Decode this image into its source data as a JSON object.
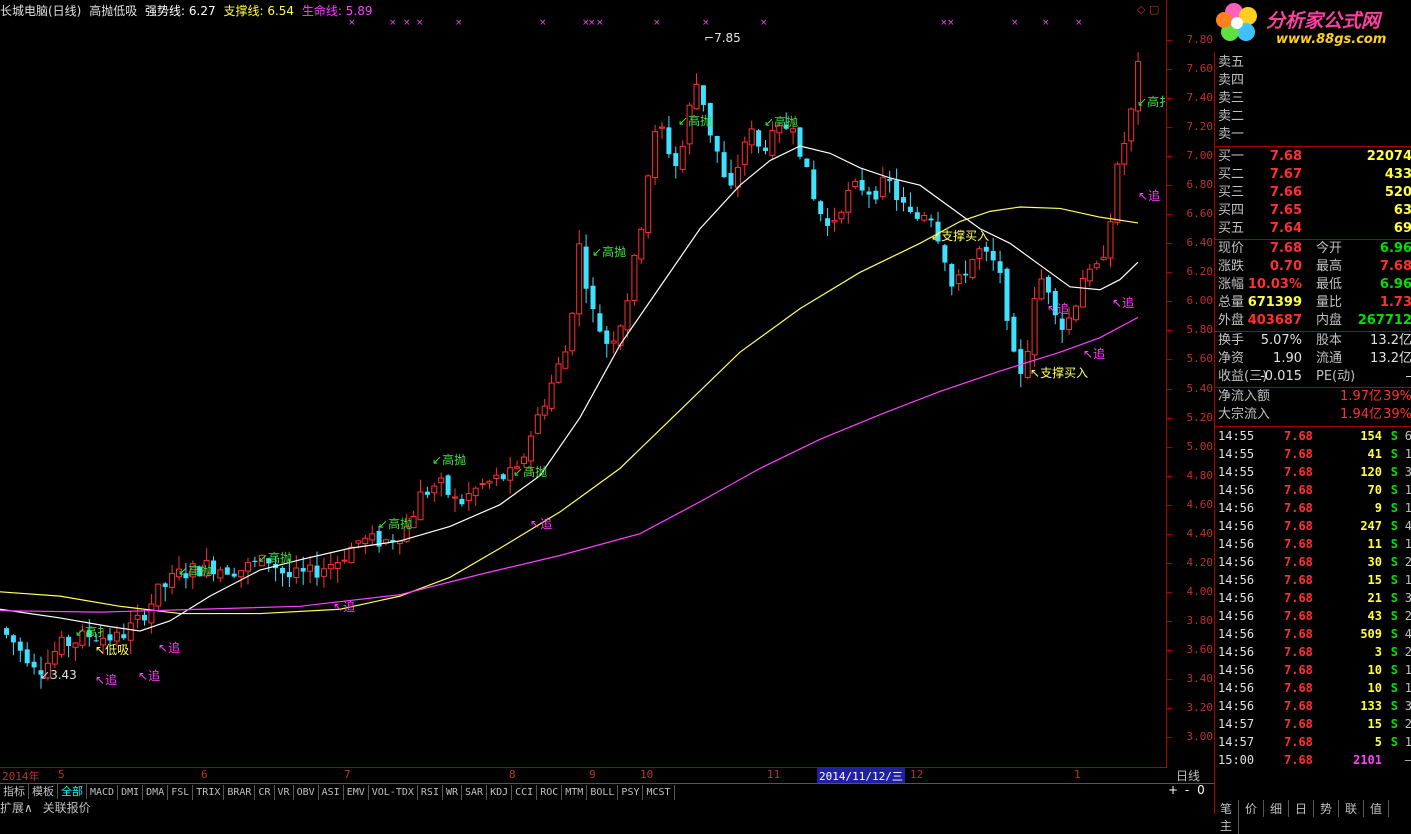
{
  "header": {
    "title": "长城电脑(日线)",
    "indicator": "高抛低吸",
    "line1_label": "强势线:",
    "line1_value": "6.27",
    "line2_label": "支撑线:",
    "line2_value": "6.54",
    "line3_label": "生命线:",
    "line3_value": "5.89",
    "icons": "◇ ▢"
  },
  "colors": {
    "up": "#ff3030",
    "down": "#40e0ff",
    "ma_white": "#ffffff",
    "ma_yellow": "#ffff60",
    "ma_magenta": "#ff40ff",
    "grid": "#a00000"
  },
  "price_axis": [
    "7.80",
    "7.60",
    "7.40",
    "7.20",
    "7.00",
    "6.80",
    "6.60",
    "6.40",
    "6.20",
    "6.00",
    "5.80",
    "5.60",
    "5.40",
    "5.20",
    "5.00",
    "4.80",
    "4.60",
    "4.40",
    "4.20",
    "4.00",
    "3.80",
    "3.60",
    "3.40",
    "3.20",
    "3.00"
  ],
  "date_axis": [
    {
      "label": "2014年",
      "x": 2
    },
    {
      "label": "5",
      "x": 58
    },
    {
      "label": "6",
      "x": 201
    },
    {
      "label": "7",
      "x": 344
    },
    {
      "label": "8",
      "x": 509
    },
    {
      "label": "9",
      "x": 589
    },
    {
      "label": "10",
      "x": 640
    },
    {
      "label": "11",
      "x": 767
    },
    {
      "label": "2014/11/12/三",
      "x": 817,
      "selected": true
    },
    {
      "label": "12",
      "x": 910
    },
    {
      "label": "1",
      "x": 1074
    }
  ],
  "period": "日线",
  "annotations": {
    "high": "7.85",
    "low": "3.43"
  },
  "signals": {
    "sell": "高抛",
    "buy_low": "低吸",
    "chase": "追",
    "support": "支撑买入",
    "sell_short": "高扌"
  },
  "chart_data": {
    "type": "candlestick",
    "title": "长城电脑(日线) 高抛低吸",
    "ylim": [
      3.0,
      7.85
    ],
    "series_names": [
      "强势线",
      "支撑线",
      "生命线"
    ],
    "latest_values": {
      "强势线": 6.27,
      "支撑线": 6.54,
      "生命线": 5.89
    },
    "high_label": 7.85,
    "low_label": 3.43
  },
  "tabs": {
    "side": [
      "指标",
      "模板",
      "全部"
    ],
    "items": [
      "MACD",
      "DMI",
      "DMA",
      "FSL",
      "TRIX",
      "BRAR",
      "CR",
      "VR",
      "OBV",
      "ASI",
      "EMV",
      "VOL-TDX",
      "RSI",
      "WR",
      "SAR",
      "KDJ",
      "CCI",
      "ROC",
      "MTM",
      "BOLL",
      "PSY",
      "MCST"
    ]
  },
  "zoom": {
    "plus": "+",
    "minus": "-",
    "zero": "0"
  },
  "bottom": {
    "expand": "扩展∧",
    "related": "关联报价"
  },
  "logo": {
    "text": "分析家公式网",
    "url": "www.88gs.com"
  },
  "panel": {
    "sell_rows": [
      "卖五",
      "卖四",
      "卖三",
      "卖二",
      "卖一"
    ],
    "buy_rows": [
      {
        "label": "买一",
        "price": "7.68",
        "vol": "22074"
      },
      {
        "label": "买二",
        "price": "7.67",
        "vol": "433"
      },
      {
        "label": "买三",
        "price": "7.66",
        "vol": "520"
      },
      {
        "label": "买四",
        "price": "7.65",
        "vol": "63"
      },
      {
        "label": "买五",
        "price": "7.64",
        "vol": "69"
      }
    ],
    "quote": [
      {
        "l1": "现价",
        "v1": "7.68",
        "l2": "今开",
        "v2": "6.96"
      },
      {
        "l1": "涨跌",
        "v1": "0.70",
        "l2": "最高",
        "v2": "7.68"
      },
      {
        "l1": "涨幅",
        "v1": "10.03%",
        "l2": "最低",
        "v2": "6.96"
      },
      {
        "l1": "总量",
        "v1": "671399",
        "l2": "量比",
        "v2": "1.73"
      },
      {
        "l1": "外盘",
        "v1": "403687",
        "l2": "内盘",
        "v2": "267712"
      }
    ],
    "info": [
      {
        "l1": "换手",
        "v1": "5.07%",
        "l2": "股本",
        "v2": "13.2亿"
      },
      {
        "l1": "净资",
        "v1": "1.90",
        "l2": "流通",
        "v2": "13.2亿"
      },
      {
        "l1": "收益(三)",
        "v1": "-0.015",
        "l2": "PE(动)",
        "v2": "–"
      }
    ],
    "flow": [
      {
        "l": "净流入额",
        "v": "1.97亿",
        "p": "39%"
      },
      {
        "l": "大宗流入",
        "v": "1.94亿",
        "p": "39%"
      }
    ],
    "ticks": [
      {
        "t": "14:55",
        "p": "7.68",
        "v": "154",
        "s": "S",
        "n": "6"
      },
      {
        "t": "14:55",
        "p": "7.68",
        "v": "41",
        "s": "S",
        "n": "1"
      },
      {
        "t": "14:55",
        "p": "7.68",
        "v": "120",
        "s": "S",
        "n": "3"
      },
      {
        "t": "14:56",
        "p": "7.68",
        "v": "70",
        "s": "S",
        "n": "1"
      },
      {
        "t": "14:56",
        "p": "7.68",
        "v": "9",
        "s": "S",
        "n": "1"
      },
      {
        "t": "14:56",
        "p": "7.68",
        "v": "247",
        "s": "S",
        "n": "4"
      },
      {
        "t": "14:56",
        "p": "7.68",
        "v": "11",
        "s": "S",
        "n": "1"
      },
      {
        "t": "14:56",
        "p": "7.68",
        "v": "30",
        "s": "S",
        "n": "2"
      },
      {
        "t": "14:56",
        "p": "7.68",
        "v": "15",
        "s": "S",
        "n": "1"
      },
      {
        "t": "14:56",
        "p": "7.68",
        "v": "21",
        "s": "S",
        "n": "3"
      },
      {
        "t": "14:56",
        "p": "7.68",
        "v": "43",
        "s": "S",
        "n": "2"
      },
      {
        "t": "14:56",
        "p": "7.68",
        "v": "509",
        "s": "S",
        "n": "4"
      },
      {
        "t": "14:56",
        "p": "7.68",
        "v": "3",
        "s": "S",
        "n": "2"
      },
      {
        "t": "14:56",
        "p": "7.68",
        "v": "10",
        "s": "S",
        "n": "1"
      },
      {
        "t": "14:56",
        "p": "7.68",
        "v": "10",
        "s": "S",
        "n": "1"
      },
      {
        "t": "14:56",
        "p": "7.68",
        "v": "133",
        "s": "S",
        "n": "3"
      },
      {
        "t": "14:57",
        "p": "7.68",
        "v": "15",
        "s": "S",
        "n": "2"
      },
      {
        "t": "14:57",
        "p": "7.68",
        "v": "5",
        "s": "S",
        "n": "1"
      },
      {
        "t": "15:00",
        "p": "7.68",
        "v": "2101",
        "s": "",
        "n": "–"
      }
    ],
    "tabs": [
      "笔",
      "价",
      "细",
      "日",
      "势",
      "联",
      "值",
      "主"
    ]
  }
}
